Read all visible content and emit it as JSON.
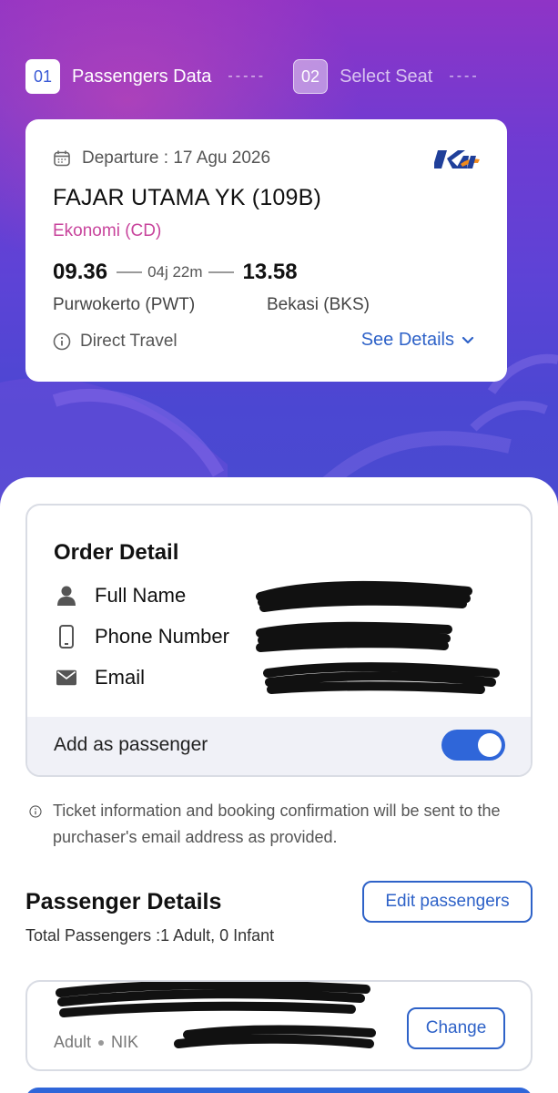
{
  "stepper": {
    "steps": [
      {
        "number": "01",
        "label": "Passengers Data"
      },
      {
        "number": "02",
        "label": "Select Seat"
      }
    ],
    "dash": "-----",
    "dash_tail": "----"
  },
  "trip": {
    "departure_label": "Departure : 17 Agu 2026",
    "operator_logo_text": "KAI",
    "train_name": "FAJAR UTAMA YK (109B)",
    "train_class": "Ekonomi (CD)",
    "depart_time": "09.36",
    "duration": "04j 22m",
    "arrive_time": "13.58",
    "from_station": "Purwokerto  (PWT)",
    "to_station": "Bekasi  (BKS)",
    "travel_type": "Direct Travel",
    "see_details_label": "See Details"
  },
  "order": {
    "title": "Order Detail",
    "fields": [
      {
        "label": "Full Name",
        "icon": "person-icon"
      },
      {
        "label": "Phone Number",
        "icon": "phone-icon"
      },
      {
        "label": "Email",
        "icon": "mail-icon"
      }
    ],
    "add_as_passenger_label": "Add as passenger",
    "add_as_passenger_on": true
  },
  "info_note": "Ticket information and booking confirmation will be sent to the purchaser's email address as provided.",
  "passenger_section": {
    "title": "Passenger Details",
    "edit_label": "Edit passengers",
    "total_label": "Total Passengers :1 Adult, 0 Infant",
    "passenger": {
      "type": "Adult",
      "id_label": "NIK",
      "change_label": "Change"
    }
  },
  "colors": {
    "accent": "#2f66d9",
    "class_pink": "#c8449c",
    "hero_top": "#8f34c6",
    "hero_bottom": "#4a4bd0"
  }
}
